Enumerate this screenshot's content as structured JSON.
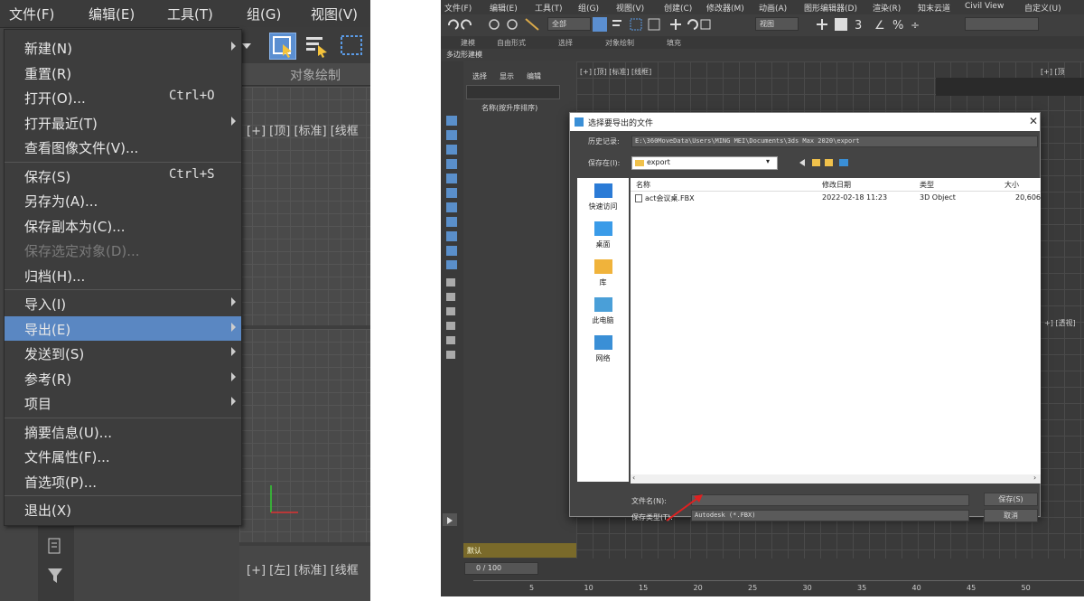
{
  "left": {
    "menubar": [
      "文件(F)",
      "编辑(E)",
      "工具(T)",
      "组(G)",
      "视图(V)"
    ],
    "toolbar_tab": "对象绘制",
    "viewport_top_label": "[+] [顶] [标准] [线框",
    "viewport_left_label": "[+] [左] [标准] [线框",
    "file_menu": [
      {
        "label": "新建(N)",
        "shortcut": "",
        "submenu": true
      },
      {
        "label": "重置(R)",
        "shortcut": "",
        "submenu": false
      },
      {
        "label": "打开(O)...",
        "shortcut": "Ctrl+O",
        "submenu": false
      },
      {
        "label": "打开最近(T)",
        "shortcut": "",
        "submenu": true
      },
      {
        "label": "查看图像文件(V)...",
        "shortcut": "",
        "submenu": false
      },
      {
        "label": "保存(S)",
        "shortcut": "Ctrl+S",
        "submenu": false
      },
      {
        "label": "另存为(A)...",
        "shortcut": "",
        "submenu": false
      },
      {
        "label": "保存副本为(C)...",
        "shortcut": "",
        "submenu": false
      },
      {
        "label": "保存选定对象(D)...",
        "shortcut": "",
        "submenu": false,
        "disabled": true
      },
      {
        "label": "归档(H)...",
        "shortcut": "",
        "submenu": false
      },
      {
        "label": "导入(I)",
        "shortcut": "",
        "submenu": true
      },
      {
        "label": "导出(E)",
        "shortcut": "",
        "submenu": true,
        "highlighted": true
      },
      {
        "label": "发送到(S)",
        "shortcut": "",
        "submenu": true
      },
      {
        "label": "参考(R)",
        "shortcut": "",
        "submenu": true
      },
      {
        "label": "项目",
        "shortcut": "",
        "submenu": true
      },
      {
        "label": "摘要信息(U)...",
        "shortcut": "",
        "submenu": false
      },
      {
        "label": "文件属性(F)...",
        "shortcut": "",
        "submenu": false
      },
      {
        "label": "首选项(P)...",
        "shortcut": "",
        "submenu": false
      },
      {
        "label": "退出(X)",
        "shortcut": "",
        "submenu": false
      }
    ]
  },
  "right": {
    "menubar": [
      "文件(F)",
      "编辑(E)",
      "工具(T)",
      "组(G)",
      "视图(V)",
      "创建(C)",
      "修改器(M)",
      "动画(A)",
      "图形编辑器(D)",
      "渲染(R)",
      "知末云道",
      "Civil View",
      "自定义(U)"
    ],
    "toolbar_dropdown": "全部",
    "toolbar_view": "视图",
    "ribbon_tabs": [
      "建模",
      "自由形式",
      "选择",
      "对象绘制",
      "填充"
    ],
    "ribbon_sub": "多边形建模",
    "explorer_tabs": [
      "选择",
      "显示",
      "编辑"
    ],
    "explorer_header": "名称(按升序排序)",
    "viewport_label": "[+] [顶] [标准] [线框]",
    "viewport_right_label": "[+] [顶",
    "viewport_persp_label": "+] [透视]",
    "scene_layer": "默认",
    "timeline_counter": "0 / 100",
    "timeline_ticks": [
      "5",
      "10",
      "15",
      "20",
      "25",
      "30",
      "35",
      "40",
      "45",
      "50"
    ],
    "dialog": {
      "title": "选择要导出的文件",
      "history_label": "历史记录:",
      "history_value": "E:\\360MoveData\\Users\\MING MEI\\Documents\\3ds Max 2020\\export",
      "save_in_label": "保存在(I):",
      "save_in_value": "export",
      "places": [
        "快速访问",
        "桌面",
        "库",
        "此电脑",
        "网络"
      ],
      "columns": [
        "名称",
        "修改日期",
        "类型",
        "大小"
      ],
      "files": [
        {
          "name": "act会议桌.FBX",
          "date": "2022-02-18 11:23",
          "type": "3D Object",
          "size": "20,606"
        }
      ],
      "filename_label": "文件名(N):",
      "filename_value": "",
      "filetype_label": "保存类型(T):",
      "filetype_value": "Autodesk (*.FBX)",
      "save_button": "保存(S)",
      "cancel_button": "取消"
    }
  }
}
